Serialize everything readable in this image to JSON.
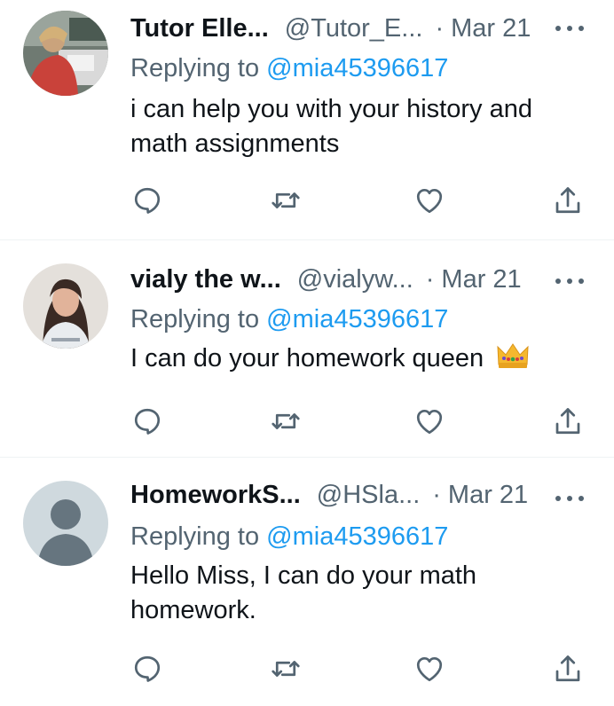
{
  "tweets": [
    {
      "name": "Tutor Elle...",
      "handle": "@Tutor_E...",
      "separator": "·",
      "date": "Mar 21",
      "replying_prefix": "Replying to ",
      "replying_to": "@mia45396617",
      "text": "i can help you with your history and math assignments",
      "avatar": "photo-tutor-at-desk"
    },
    {
      "name": "vialy the w...",
      "handle": "@vialyw...",
      "separator": "·",
      "date": "Mar 21",
      "replying_prefix": "Replying to ",
      "replying_to": "@mia45396617",
      "text": "I can do your homework queen",
      "emoji": "crown-emoji",
      "avatar": "photo-woman-portrait"
    },
    {
      "name": "HomeworkS...",
      "handle": "@HSla...",
      "separator": "·",
      "date": "Mar 21",
      "replying_prefix": "Replying to ",
      "replying_to": "@mia45396617",
      "text": "Hello Miss, I can do your math homework.",
      "avatar": "default-avatar"
    }
  ],
  "icons": {
    "reply": "reply-icon",
    "retweet": "retweet-icon",
    "like": "like-icon",
    "share": "share-icon",
    "more": "more-icon"
  },
  "colors": {
    "text": "#0f1419",
    "secondary": "#536471",
    "link": "#1d9bf0",
    "divider": "#eff3f4"
  }
}
